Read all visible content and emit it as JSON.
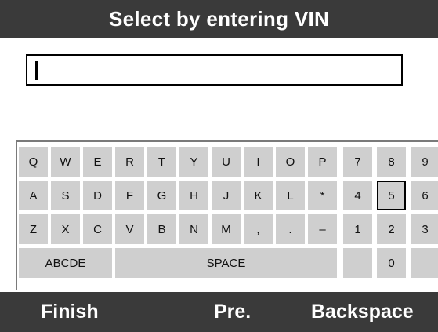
{
  "header": {
    "title": "Select by entering VIN"
  },
  "vin_field": {
    "value": ""
  },
  "keyboard": {
    "rows": [
      [
        "Q",
        "W",
        "E",
        "R",
        "T",
        "Y",
        "U",
        "I",
        "O",
        "P"
      ],
      [
        "A",
        "S",
        "D",
        "F",
        "G",
        "H",
        "J",
        "K",
        "L",
        "*"
      ],
      [
        "Z",
        "X",
        "C",
        "V",
        "B",
        "N",
        "M",
        ",",
        ".",
        "–"
      ]
    ],
    "numpad_rows": [
      [
        "7",
        "8",
        "9"
      ],
      [
        "4",
        "5",
        "6"
      ],
      [
        "1",
        "2",
        "3"
      ]
    ],
    "mode_label": "ABCDE",
    "space_label": "SPACE",
    "zero_label": "0",
    "selected_key": "5"
  },
  "footer": {
    "finish_label": "Finish",
    "pre_label": "Pre.",
    "backspace_label": "Backspace"
  }
}
